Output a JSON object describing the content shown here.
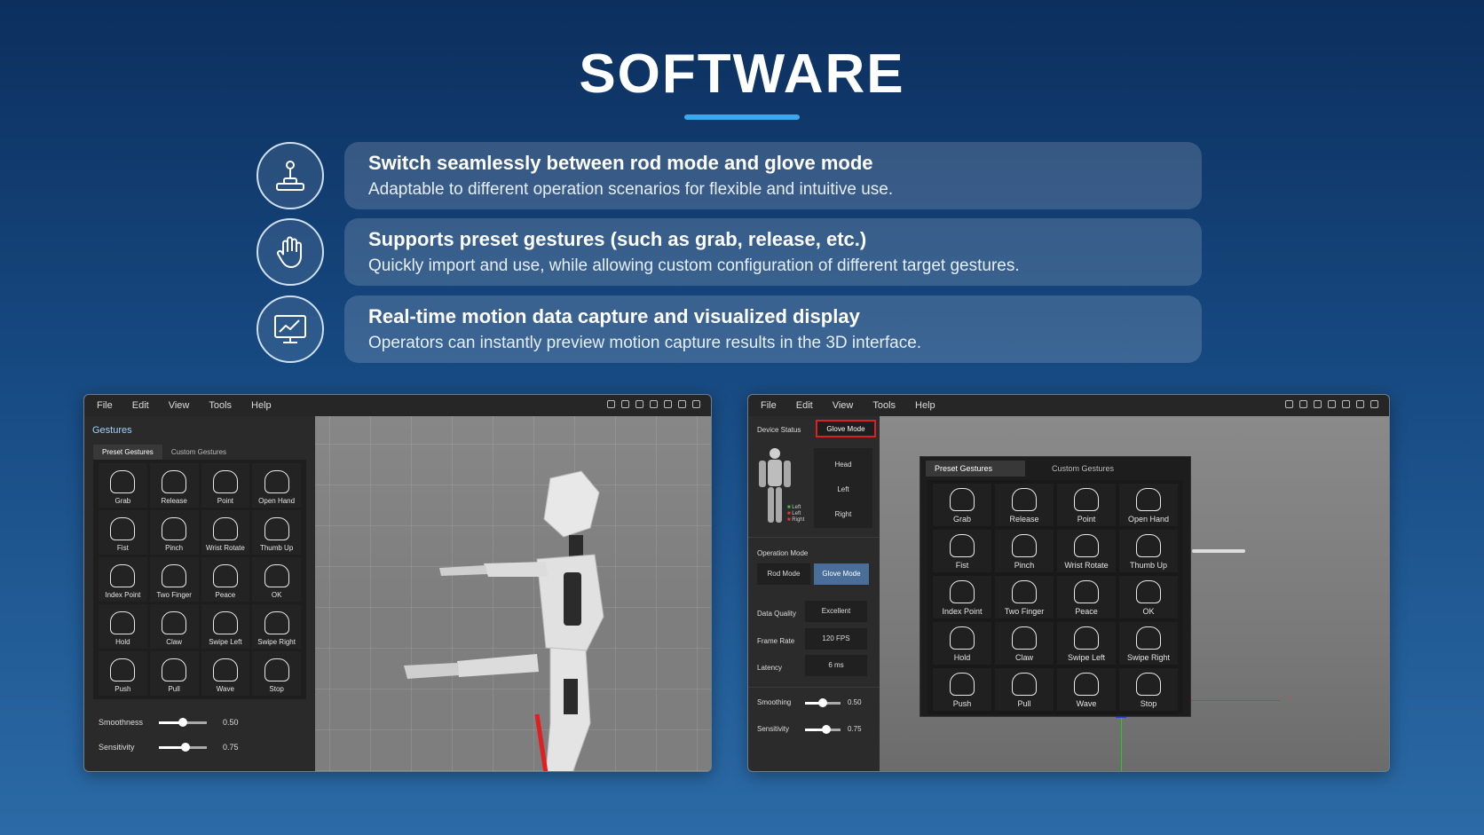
{
  "page": {
    "title": "SOFTWARE"
  },
  "features": [
    {
      "icon": "joystick-icon",
      "title": "Switch seamlessly between rod mode and glove mode",
      "description": "Adaptable to different operation scenarios for flexible and intuitive use."
    },
    {
      "icon": "hand-icon",
      "title": "Supports preset gestures (such as grab, release, etc.)",
      "description": "Quickly import and use, while allowing custom configuration of different target gestures."
    },
    {
      "icon": "monitor-chart-icon",
      "title": "Real-time motion data capture and visualized display",
      "description": "Operators can instantly preview motion capture results in the 3D interface."
    }
  ],
  "left_window": {
    "menu": [
      "File",
      "Edit",
      "View",
      "Tools",
      "Help"
    ],
    "panel_title": "Gestures",
    "tabs": [
      "Preset Gestures",
      "Custom Gestures"
    ],
    "gestures": [
      "Grab",
      "Release",
      "Point",
      "Open Hand",
      "Fist",
      "Pinch",
      "Wrist Rotate",
      "Thumb Up",
      "Index Point",
      "Two Finger",
      "Peace",
      "OK",
      "Hold",
      "Claw",
      "Swipe Left",
      "Swipe Right",
      "Push",
      "Pull",
      "Wave",
      "Stop"
    ],
    "sliders": [
      {
        "label": "Smoothness",
        "value": "0.50",
        "fraction": 0.5
      },
      {
        "label": "Sensitivity",
        "value": "0.75",
        "fraction": 0.55
      }
    ]
  },
  "right_window": {
    "menu": [
      "File",
      "Edit",
      "View",
      "Tools",
      "Help"
    ],
    "device_status_label": "Device Status",
    "glove_mode_badge": "Glove Mode",
    "body_parts": [
      "Head",
      "Left",
      "Right"
    ],
    "mini_legend": [
      "Left",
      "Left",
      "Right"
    ],
    "operation_mode_label": "Operation Mode",
    "mode_buttons": [
      "Rod Mode",
      "Glove Mode"
    ],
    "stats": [
      {
        "label": "Data Quality",
        "value": "Excellent"
      },
      {
        "label": "Frame Rate",
        "value": "120 FPS"
      },
      {
        "label": "Latency",
        "value": "6 ms"
      }
    ],
    "sliders": [
      {
        "label": "Smoothing",
        "value": "0.50",
        "fraction": 0.5
      },
      {
        "label": "Sensitivity",
        "value": "0.75",
        "fraction": 0.6
      }
    ],
    "tabs": [
      "Preset Gestures",
      "Custom Gestures"
    ],
    "gestures": [
      "Grab",
      "Release",
      "Point",
      "Open Hand",
      "Fist",
      "Pinch",
      "Wrist Rotate",
      "Thumb Up",
      "Index Point",
      "Two Finger",
      "Peace",
      "OK",
      "Hold",
      "Claw",
      "Swipe Left",
      "Swipe Right",
      "Push",
      "Pull",
      "Wave",
      "Stop"
    ]
  }
}
